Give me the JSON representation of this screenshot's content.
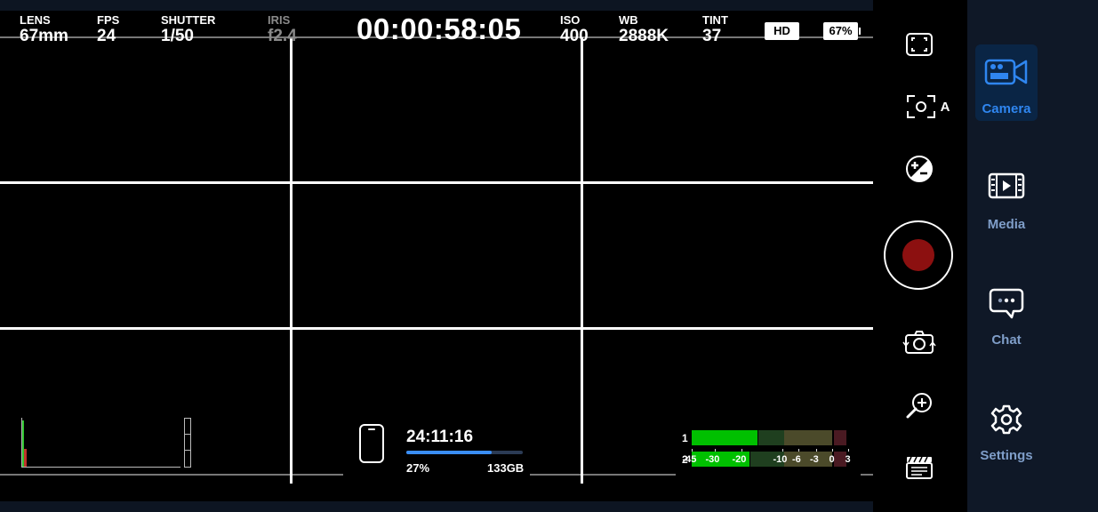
{
  "viewfinder": {
    "params": [
      {
        "label": "LENS",
        "value": "67mm"
      },
      {
        "label": "FPS",
        "value": "24"
      },
      {
        "label": "SHUTTER",
        "value": "1/50"
      },
      {
        "label": "IRIS",
        "value": "f2.4",
        "dimmed": true
      }
    ],
    "timecode": "00:00:58:05",
    "params_right": [
      {
        "label": "ISO",
        "value": "400"
      },
      {
        "label": "WB",
        "value": "2888K"
      },
      {
        "label": "TINT",
        "value": "37"
      }
    ],
    "resolution_badge": "HD",
    "battery_badge": "67%"
  },
  "storage": {
    "remaining_time": "24:11:16",
    "percent": "27%",
    "capacity": "133GB",
    "bar_fill_fraction": 0.73
  },
  "audio_meters": {
    "channels": [
      "1",
      "2"
    ],
    "scale": [
      "-45",
      "-30",
      "-20",
      "-10",
      "-6",
      "-3",
      "0",
      "3"
    ],
    "levels": [
      -16,
      -18
    ],
    "colors": {
      "green": "#00c000",
      "green_dim": "#1f3f1f",
      "yellow_dim": "#4b4a2a",
      "red_dim": "#4a1a22"
    }
  },
  "toolbar": {
    "icons": [
      "frame-guides-icon",
      "auto-focus-icon",
      "exposure-compensation-icon",
      "record-button",
      "flip-camera-icon",
      "zoom-in-icon",
      "clapperboard-icon"
    ],
    "auto_focus_label": "A",
    "record_color": "#8c1010"
  },
  "nav": {
    "items": [
      {
        "label": "Camera",
        "icon": "video-camera-icon",
        "active": true
      },
      {
        "label": "Media",
        "icon": "film-play-icon",
        "active": false
      },
      {
        "label": "Chat",
        "icon": "chat-bubble-icon",
        "active": false
      },
      {
        "label": "Settings",
        "icon": "gear-icon",
        "active": false
      }
    ],
    "active_color": "#2f86f0",
    "inactive_color": "#7f9ec9"
  }
}
